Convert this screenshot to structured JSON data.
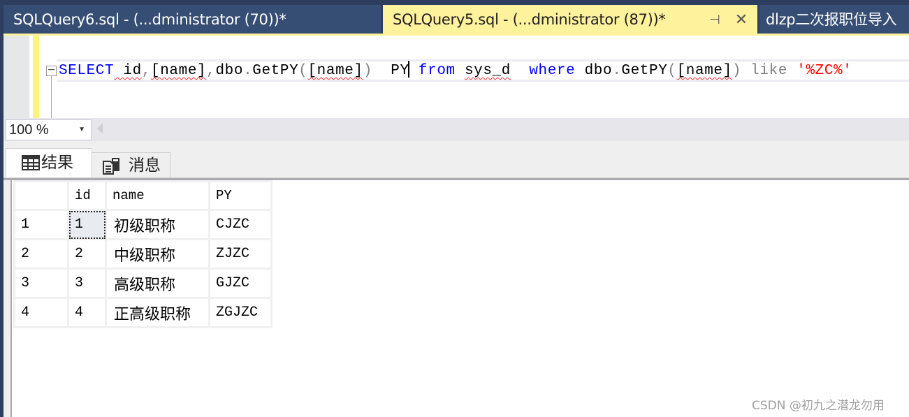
{
  "tabs": [
    {
      "label": "SQLQuery6.sql - (...dministrator (70))*",
      "active": false
    },
    {
      "label": "SQLQuery5.sql - (...dministrator (87))*",
      "active": true
    },
    {
      "label": "dlzp二次报职位导入",
      "active": false
    }
  ],
  "tab_icons": {
    "pin": "pin-icon",
    "close": "close-icon"
  },
  "tab_glyphs": {
    "pin": "⊣",
    "close": "✕"
  },
  "editor": {
    "collapse_glyph": "−",
    "tokens": {
      "select": "SELECT",
      "t1": " id",
      "comma1": ",",
      "name1": "[name]",
      "comma2": ",",
      "dbo1": "dbo",
      "dot1": ".",
      "getpy1": "GetPY",
      "lp1": "(",
      "name2": "[name]",
      "rp1": ")",
      "alias": "  PY",
      "from": " from",
      "sp1": " ",
      "table": "sys_d",
      "where": "  where",
      "sp2": " dbo",
      "dot2": ".",
      "getpy2": "GetPY",
      "lp2": "(",
      "name3": "[name]",
      "rp2": ")",
      "like": " like",
      "str": " '%ZC%'"
    }
  },
  "zoom": {
    "value": "100 %",
    "arrow": "▼"
  },
  "results_tabs": [
    {
      "label": "结果",
      "icon": "grid-icon",
      "active": true
    },
    {
      "label": "消息",
      "icon": "messages-icon",
      "active": false
    }
  ],
  "grid": {
    "columns": [
      "",
      "id",
      "name",
      "PY"
    ],
    "rows": [
      {
        "row": "1",
        "id": "1",
        "name": "初级职称",
        "py": "CJZC"
      },
      {
        "row": "2",
        "id": "2",
        "name": "中级职称",
        "py": "ZJZC"
      },
      {
        "row": "3",
        "id": "3",
        "name": "高级职称",
        "py": "GJZC"
      },
      {
        "row": "4",
        "id": "4",
        "name": "正高级职称",
        "py": "ZGJZC"
      }
    ],
    "selected_cell": {
      "row": 1,
      "column": "id"
    }
  },
  "watermark": "CSDN @初九之潜龙勿用",
  "colors": {
    "tab_active_bg": "#fff29d",
    "tab_inactive_bg": "#364e74",
    "keyword": "#0000ff",
    "string": "#ff0000",
    "operator": "#808080"
  }
}
